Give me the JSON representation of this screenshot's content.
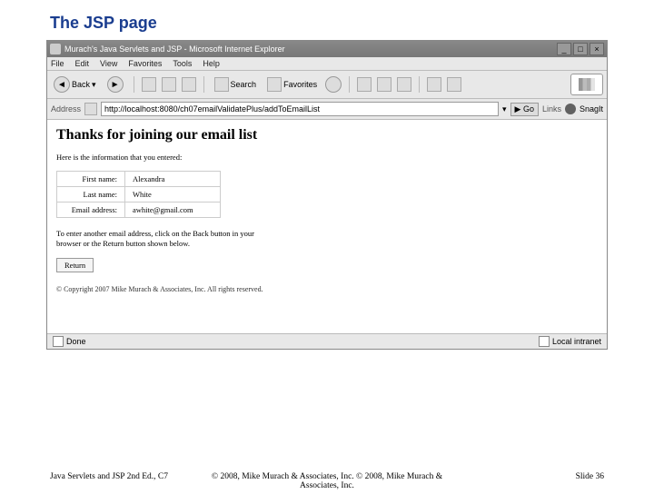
{
  "slide": {
    "title": "The JSP page",
    "footerLeft": "Java Servlets and JSP 2nd Ed., C7",
    "footerCenter": "© 2008, Mike Murach & Associates, Inc. © 2008, Mike Murach & Associates, Inc.",
    "footerRight": "Slide 36"
  },
  "browser": {
    "title": "Murach's Java Servlets and JSP - Microsoft Internet Explorer",
    "menu": {
      "file": "File",
      "edit": "Edit",
      "view": "View",
      "favorites": "Favorites",
      "tools": "Tools",
      "help": "Help"
    },
    "toolbar": {
      "back": "Back",
      "search": "Search",
      "favorites": "Favorites"
    },
    "address": {
      "label": "Address",
      "url": "http://localhost:8080/ch07emailValidatePlus/addToEmailList",
      "go": "Go",
      "links": "Links",
      "snagit": "SnagIt"
    },
    "status": {
      "done": "Done",
      "zone": "Local intranet"
    }
  },
  "page": {
    "heading": "Thanks for joining our email list",
    "intro": "Here is the information that you entered:",
    "fields": {
      "firstNameLabel": "First name:",
      "firstNameValue": "Alexandra",
      "lastNameLabel": "Last name:",
      "lastNameValue": "White",
      "emailLabel": "Email address:",
      "emailValue": "awhite@gmail.com"
    },
    "instructions": "To enter another email address, click on the Back button in your browser or the Return button shown below.",
    "returnLabel": "Return",
    "copyright": "© Copyright 2007 Mike Murach & Associates, Inc. All rights reserved."
  }
}
